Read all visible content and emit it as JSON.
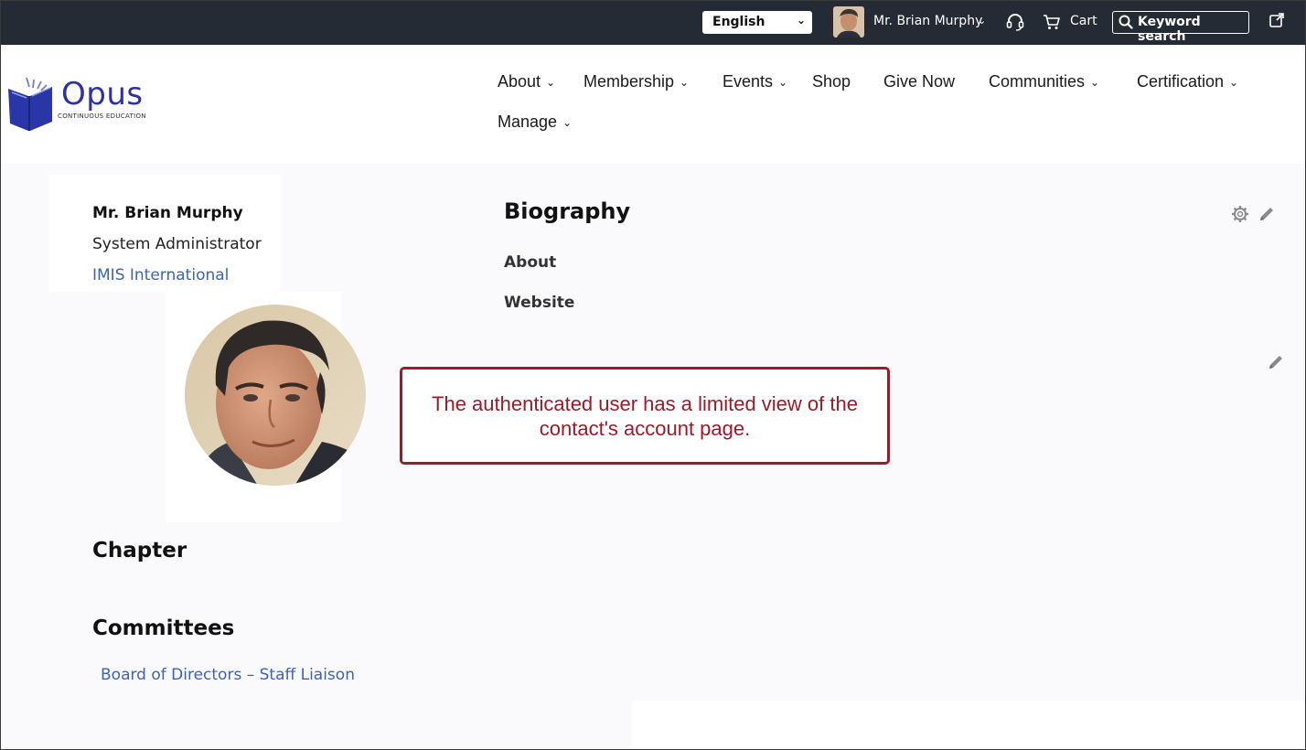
{
  "topbar": {
    "language": "English",
    "user_name": "Mr. Brian Murphy",
    "cart_label": "Cart",
    "search_placeholder": "Keyword search"
  },
  "logo": {
    "name": "Opus",
    "tagline": "CONTINUOUS   EDUCATION"
  },
  "nav": {
    "items": [
      {
        "label": "About",
        "has_menu": true
      },
      {
        "label": "Membership",
        "has_menu": true
      },
      {
        "label": "Events",
        "has_menu": true
      },
      {
        "label": "Shop",
        "has_menu": false
      },
      {
        "label": "Give Now",
        "has_menu": false
      },
      {
        "label": "Communities",
        "has_menu": true
      },
      {
        "label": "Certification",
        "has_menu": true
      },
      {
        "label": "Manage",
        "has_menu": true
      }
    ]
  },
  "profile": {
    "name": "Mr. Brian Murphy",
    "title": "System Administrator",
    "organization": "IMIS International"
  },
  "biography": {
    "heading": "Biography",
    "about_label": "About",
    "website_label": "Website"
  },
  "callout": {
    "text": "The authenticated user has a limited view of the contact's account page."
  },
  "chapter": {
    "heading": "Chapter"
  },
  "committees": {
    "heading": "Committees",
    "items": [
      "Board of Directors – Staff Liaison"
    ]
  },
  "colors": {
    "topbar_bg": "#252b35",
    "link": "#3f63b4",
    "callout": "#9b1b2a",
    "logo": "#2e31a6"
  }
}
